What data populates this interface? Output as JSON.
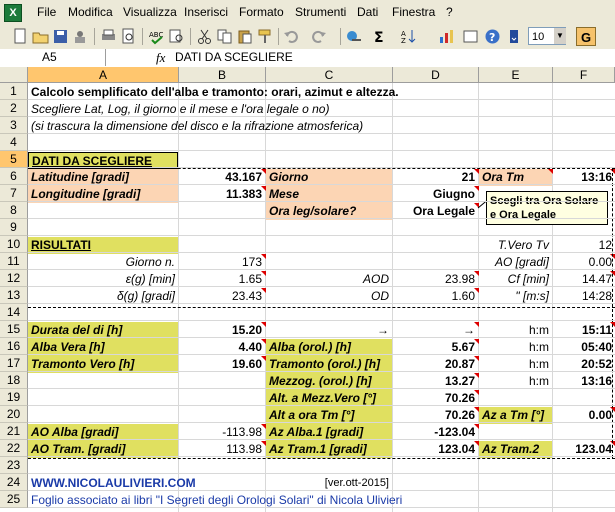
{
  "menubar": {
    "items": [
      "File",
      "Modifica",
      "Visualizza",
      "Inserisci",
      "Formato",
      "Strumenti",
      "Dati",
      "Finestra",
      "?"
    ]
  },
  "toolbar": {
    "zoom": "10",
    "bold_label": "G"
  },
  "formula_bar": {
    "name_box": "A5",
    "fx": "fx",
    "formula": "DATI DA SCEGLIERE"
  },
  "columns": [
    "A",
    "B",
    "C",
    "D",
    "E",
    "F"
  ],
  "rows": [
    "1",
    "2",
    "3",
    "4",
    "5",
    "6",
    "7",
    "8",
    "9",
    "10",
    "11",
    "12",
    "13",
    "14",
    "15",
    "16",
    "17",
    "18",
    "19",
    "20",
    "21",
    "22",
    "23",
    "24",
    "25"
  ],
  "cells": {
    "r1": "Calcolo semplificato dell'alba e tramonto: orari, azimut e altezza.",
    "r2": "Scegliere Lat, Log, il giorno e il mese e l'ora legale o no)",
    "r3": "(si trascura la dimensione del disco e la rifrazione atmosferica)",
    "r5a": "DATI DA SCEGLIERE",
    "r6a": "Latitudine [gradi]",
    "r6b": "43.167",
    "r6c": "Giorno",
    "r6d": "21",
    "r6e": "Ora Tm",
    "r6f": "13:16",
    "r7a": "Longitudine [gradi]",
    "r7b": "11.383",
    "r7c": "Mese",
    "r7d": "Giugno",
    "r8c": "Ora leg/solare?",
    "r8d": "Ora Legale",
    "r10a": "RISULTATI",
    "r10e": "T.Vero Tv",
    "r10f": "12",
    "r11a": "Giorno n.",
    "r11b": "173",
    "r11e": "AO [gradi]",
    "r11f": "0.00",
    "r12a": "ε(g) [min]",
    "r12b": "1.65",
    "r12c": "AOD",
    "r12d": "23.98",
    "r12e": "Cf [min]",
    "r12f": "14.47",
    "r13a": "δ(g) [gradi]",
    "r13b": "23.43",
    "r13c": "OD",
    "r13d": "1.60",
    "r13e": "\" [m:s]",
    "r13f": "14:28",
    "r15a": "Durata del di [h]",
    "r15b": "15.20",
    "r15c": "→",
    "r15d": "→",
    "r15e": "h:m",
    "r15f": "15:11",
    "r16a": "Alba Vera [h]",
    "r16b": "4.40",
    "r16c": "Alba (orol.) [h]",
    "r16d": "5.67",
    "r16e": "h:m",
    "r16f": "05:40",
    "r17a": "Tramonto Vero [h]",
    "r17b": "19.60",
    "r17c": "Tramonto (orol.) [h]",
    "r17d": "20.87",
    "r17e": "h:m",
    "r17f": "20:52",
    "r18c": "Mezzog. (orol.) [h]",
    "r18d": "13.27",
    "r18e": "h:m",
    "r18f": "13:16",
    "r19c": "Alt. a Mezz.Vero [°]",
    "r19d": "70.26",
    "r20c": "Alt a ora Tm [°]",
    "r20d": "70.26",
    "r20e": "Az a Tm [°]",
    "r20f": "0.00",
    "r21a": "AO Alba [gradi]",
    "r21b": "-113.98",
    "r21c": "Az Alba.1  [gradi]",
    "r21d": "-123.04",
    "r22a": "AO Tram. [gradi]",
    "r22b": "113.98",
    "r22c": "Az Tram.1  [gradi]",
    "r22d": "123.04",
    "r22e": "Az Tram.2",
    "r22f": "123.04",
    "r24a": "WWW.NICOLAULIVIERI.COM",
    "r24d": "[ver.ott-2015]",
    "r25a": "Foglio associato ai libri \"I Segreti degli Orologi Solari\" di Nicola Ulivieri"
  },
  "comment": "Scegli tra Ora Solare e Ora Legale",
  "colors": {
    "peach": "#fcd5b4",
    "yellow": "#e0e060",
    "link": "#1a3aa8",
    "selected_header": "#ffc66e"
  }
}
